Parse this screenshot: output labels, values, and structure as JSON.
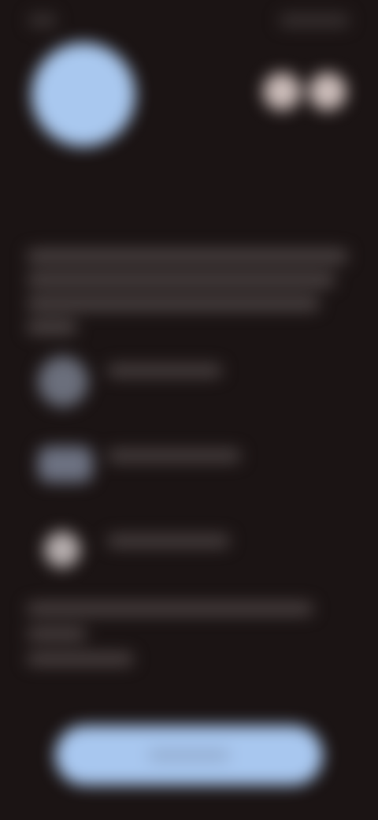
{
  "screen": {
    "background_color": "#1b1414",
    "accent_color": "#a8c7ef",
    "text_visible": false
  },
  "status_bar": {
    "time_label": "",
    "status_icons_label": ""
  },
  "hero": {
    "avatar_label": "",
    "action_1_label": "",
    "action_2_label": ""
  },
  "content": {
    "paragraph_lines": [
      "",
      "",
      "",
      ""
    ],
    "items": [
      {
        "label": "",
        "icon": "circle-icon"
      },
      {
        "label": "",
        "icon": "card-icon"
      },
      {
        "label": "",
        "icon": "badge-icon"
      }
    ],
    "note_lines": [
      "",
      "",
      ""
    ]
  },
  "footer": {
    "primary_button_label": ""
  }
}
